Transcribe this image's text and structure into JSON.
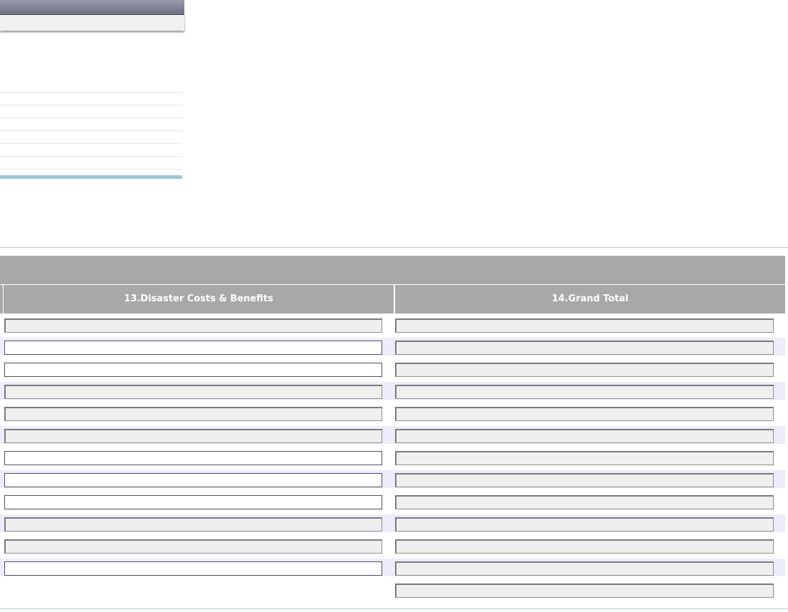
{
  "sidebar": {
    "header_label": "",
    "band_label": "",
    "items": [
      "",
      "",
      "",
      "",
      "",
      "",
      ""
    ]
  },
  "section": {
    "title": ""
  },
  "table": {
    "columns": [
      {
        "label": "13.Disaster Costs & Benefits"
      },
      {
        "label": "14.Grand Total"
      }
    ],
    "rows": [
      {
        "left": {
          "value": "",
          "editable": false
        },
        "right": {
          "value": "",
          "editable": false
        }
      },
      {
        "left": {
          "value": "",
          "editable": true
        },
        "right": {
          "value": "",
          "editable": false
        }
      },
      {
        "left": {
          "value": "",
          "editable": true
        },
        "right": {
          "value": "",
          "editable": false
        }
      },
      {
        "left": {
          "value": "",
          "editable": false
        },
        "right": {
          "value": "",
          "editable": false
        }
      },
      {
        "left": {
          "value": "",
          "editable": false
        },
        "right": {
          "value": "",
          "editable": false
        }
      },
      {
        "left": {
          "value": "",
          "editable": false
        },
        "right": {
          "value": "",
          "editable": false
        }
      },
      {
        "left": {
          "value": "",
          "editable": true
        },
        "right": {
          "value": "",
          "editable": false
        }
      },
      {
        "left": {
          "value": "",
          "editable": true
        },
        "right": {
          "value": "",
          "editable": false
        }
      },
      {
        "left": {
          "value": "",
          "editable": true
        },
        "right": {
          "value": "",
          "editable": false
        }
      },
      {
        "left": {
          "value": "",
          "editable": false
        },
        "right": {
          "value": "",
          "editable": false
        }
      },
      {
        "left": {
          "value": "",
          "editable": false
        },
        "right": {
          "value": "",
          "editable": false
        }
      },
      {
        "left": {
          "value": "",
          "editable": true
        },
        "right": {
          "value": "",
          "editable": false
        }
      }
    ],
    "grand_total_value": ""
  }
}
